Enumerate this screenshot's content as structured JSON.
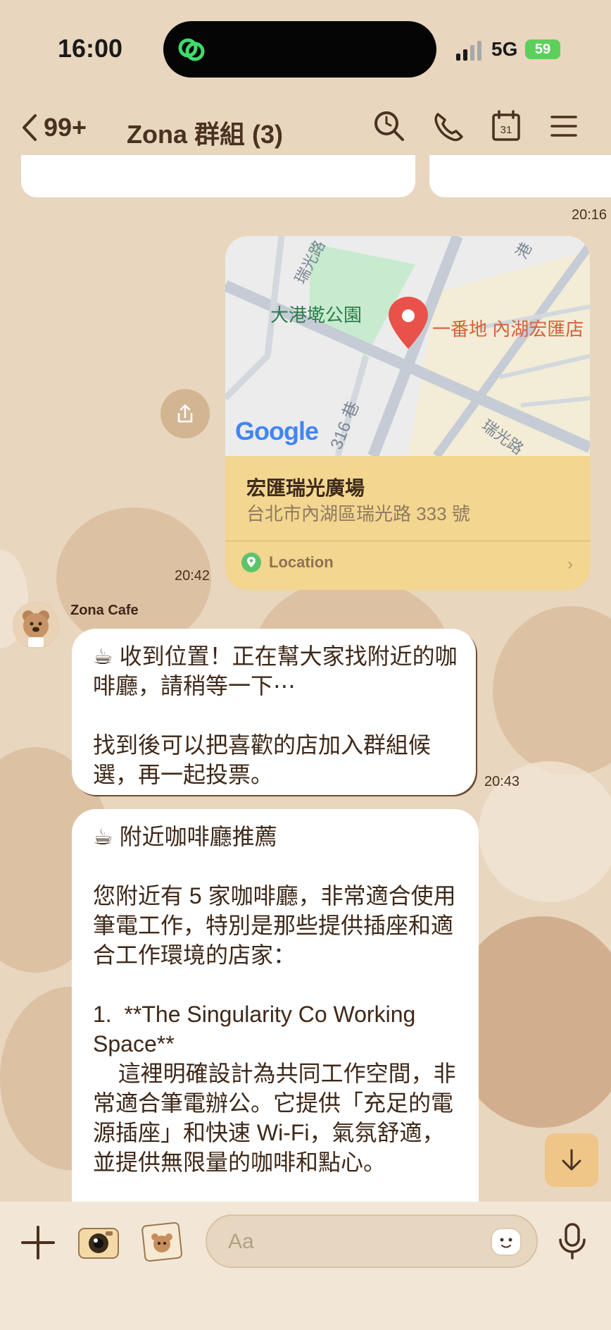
{
  "status_bar": {
    "time": "16:00",
    "network": "5G",
    "battery": "59"
  },
  "header": {
    "back_count": "99+",
    "title": "Zona 群組 (3)",
    "icons": [
      "search-icon",
      "phone-icon",
      "calendar-icon",
      "menu-icon"
    ],
    "calendar_day": "31"
  },
  "messages": {
    "map_time": "20:16",
    "location": {
      "map_labels": {
        "park": "大港墘公園",
        "pin": "一番地 內湖宏匯店",
        "road1": "瑞光路",
        "road2": "316 巷",
        "road3": "瑞光路",
        "road4": "港"
      },
      "logo": "Google",
      "place_name": "宏匯瑞光廣場",
      "address": "台北市內湖區瑞光路 333 號",
      "label": "Location",
      "time": "20:42"
    },
    "sender": "Zona Cafe",
    "bubble1": {
      "text": "☕ 收到位置！正在幫大家找附近的咖啡廳，請稍等一下⋯\n\n找到後可以把喜歡的店加入群組候選，再一起投票。",
      "time": "20:43"
    },
    "bubble2": {
      "text": "☕ 附近咖啡廳推薦\n\n您附近有 5 家咖啡廳，非常適合使用筆電工作，特別是那些提供插座和適合工作環境的店家：\n\n1.  **The Singularity Co Working Space**\n    這裡明確設計為共同工作空間，非常適合筆電辦公。它提供「充足的電源插座」和快速 Wi-Fi，氣氛舒適，並提供無限量的咖啡和點心。"
    }
  },
  "input": {
    "placeholder": "Aa"
  },
  "colors": {
    "background": "#e8d6bf",
    "accent": "#4a3120",
    "location_card": "#f3d68f",
    "scroll_button": "#efc588"
  }
}
